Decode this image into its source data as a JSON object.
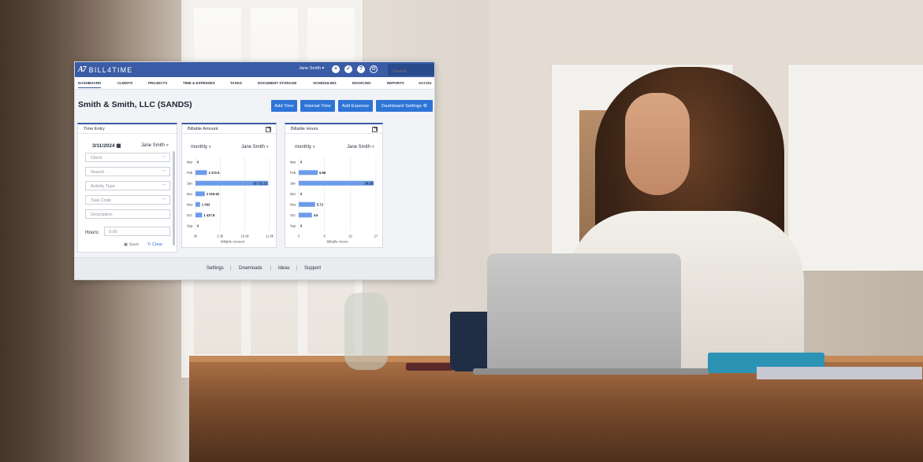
{
  "app": {
    "brand": "BILL4TIME",
    "brand_mark": "A7",
    "user_menu": "Jane Smith ▾",
    "search_placeholder": "Search",
    "colors": {
      "primary": "#3a5ba5",
      "button": "#2e74d6",
      "bar": "#6c9bea"
    }
  },
  "nav": {
    "items": [
      "DASHBOARD",
      "CLIENTS",
      "PROJECTS",
      "TIME & EXPENSES",
      "TASKS",
      "DOCUMENT STORAGE",
      "SCHEDULING",
      "INVOICING",
      "REPORTS",
      "ACCOU"
    ],
    "active": "DASHBOARD"
  },
  "page": {
    "title": "Smith & Smith, LLC (SANDS)",
    "buttons": {
      "add_time": "Add Time",
      "internal_time": "Internal Time",
      "add_expense": "Add Expense",
      "dashboard_settings": "Dashboard Settings ⚙"
    }
  },
  "time_entry": {
    "title": "Time Entry",
    "date": "3/11/2024 ▦",
    "user": "Jane Smith ▿",
    "fields": [
      "Client",
      "Search",
      "Activity Type",
      "Task Code",
      "Description"
    ],
    "hours_label": "Hours:",
    "hours_placeholder": "0.00",
    "save": "▣ Save",
    "clear": "↻ Clear"
  },
  "billable_amount": {
    "title": "Billable Amount",
    "period": "monthly ▿",
    "user": "Jane Smith ▿"
  },
  "billable_hours": {
    "title": "Billable Hours",
    "period": "monthly ▿",
    "user": "Jane Smith ▿"
  },
  "chart_data": [
    {
      "type": "bar",
      "orientation": "horizontal",
      "categories": [
        "Mar",
        "Feb",
        "Jan",
        "Dec",
        "Nov",
        "Oct",
        "Sep"
      ],
      "values": [
        0,
        2472.5,
        15711.21,
        2015.52,
        1003,
        1427.8,
        0
      ],
      "value_labels": [
        "0",
        "2 472.5",
        "15 711.21",
        "2 015.52",
        "1 003",
        "1 427.8",
        "0"
      ],
      "xticks": [
        "0k",
        "5.3k",
        "10.6k",
        "11.9k"
      ],
      "xlabel": "Billable Amount",
      "xlim": [
        0,
        16000
      ]
    },
    {
      "type": "bar",
      "orientation": "horizontal",
      "categories": [
        "Mar",
        "Feb",
        "Jan",
        "Dec",
        "Nov",
        "Oct",
        "Sep"
      ],
      "values": [
        0,
        6.65,
        26.25,
        0,
        5.72,
        4.6,
        0
      ],
      "value_labels": [
        "0",
        "6.65",
        "26.25",
        "0",
        "5.72",
        "4.6",
        "0"
      ],
      "xticks": [
        "0",
        "9",
        "18",
        "27"
      ],
      "xlabel": "Billable Hours",
      "xlim": [
        0,
        27
      ]
    }
  ],
  "footer": {
    "settings": "Settings",
    "downloads": "Downloads",
    "ideas": "Ideas",
    "support": "Support",
    "sep": "|"
  }
}
